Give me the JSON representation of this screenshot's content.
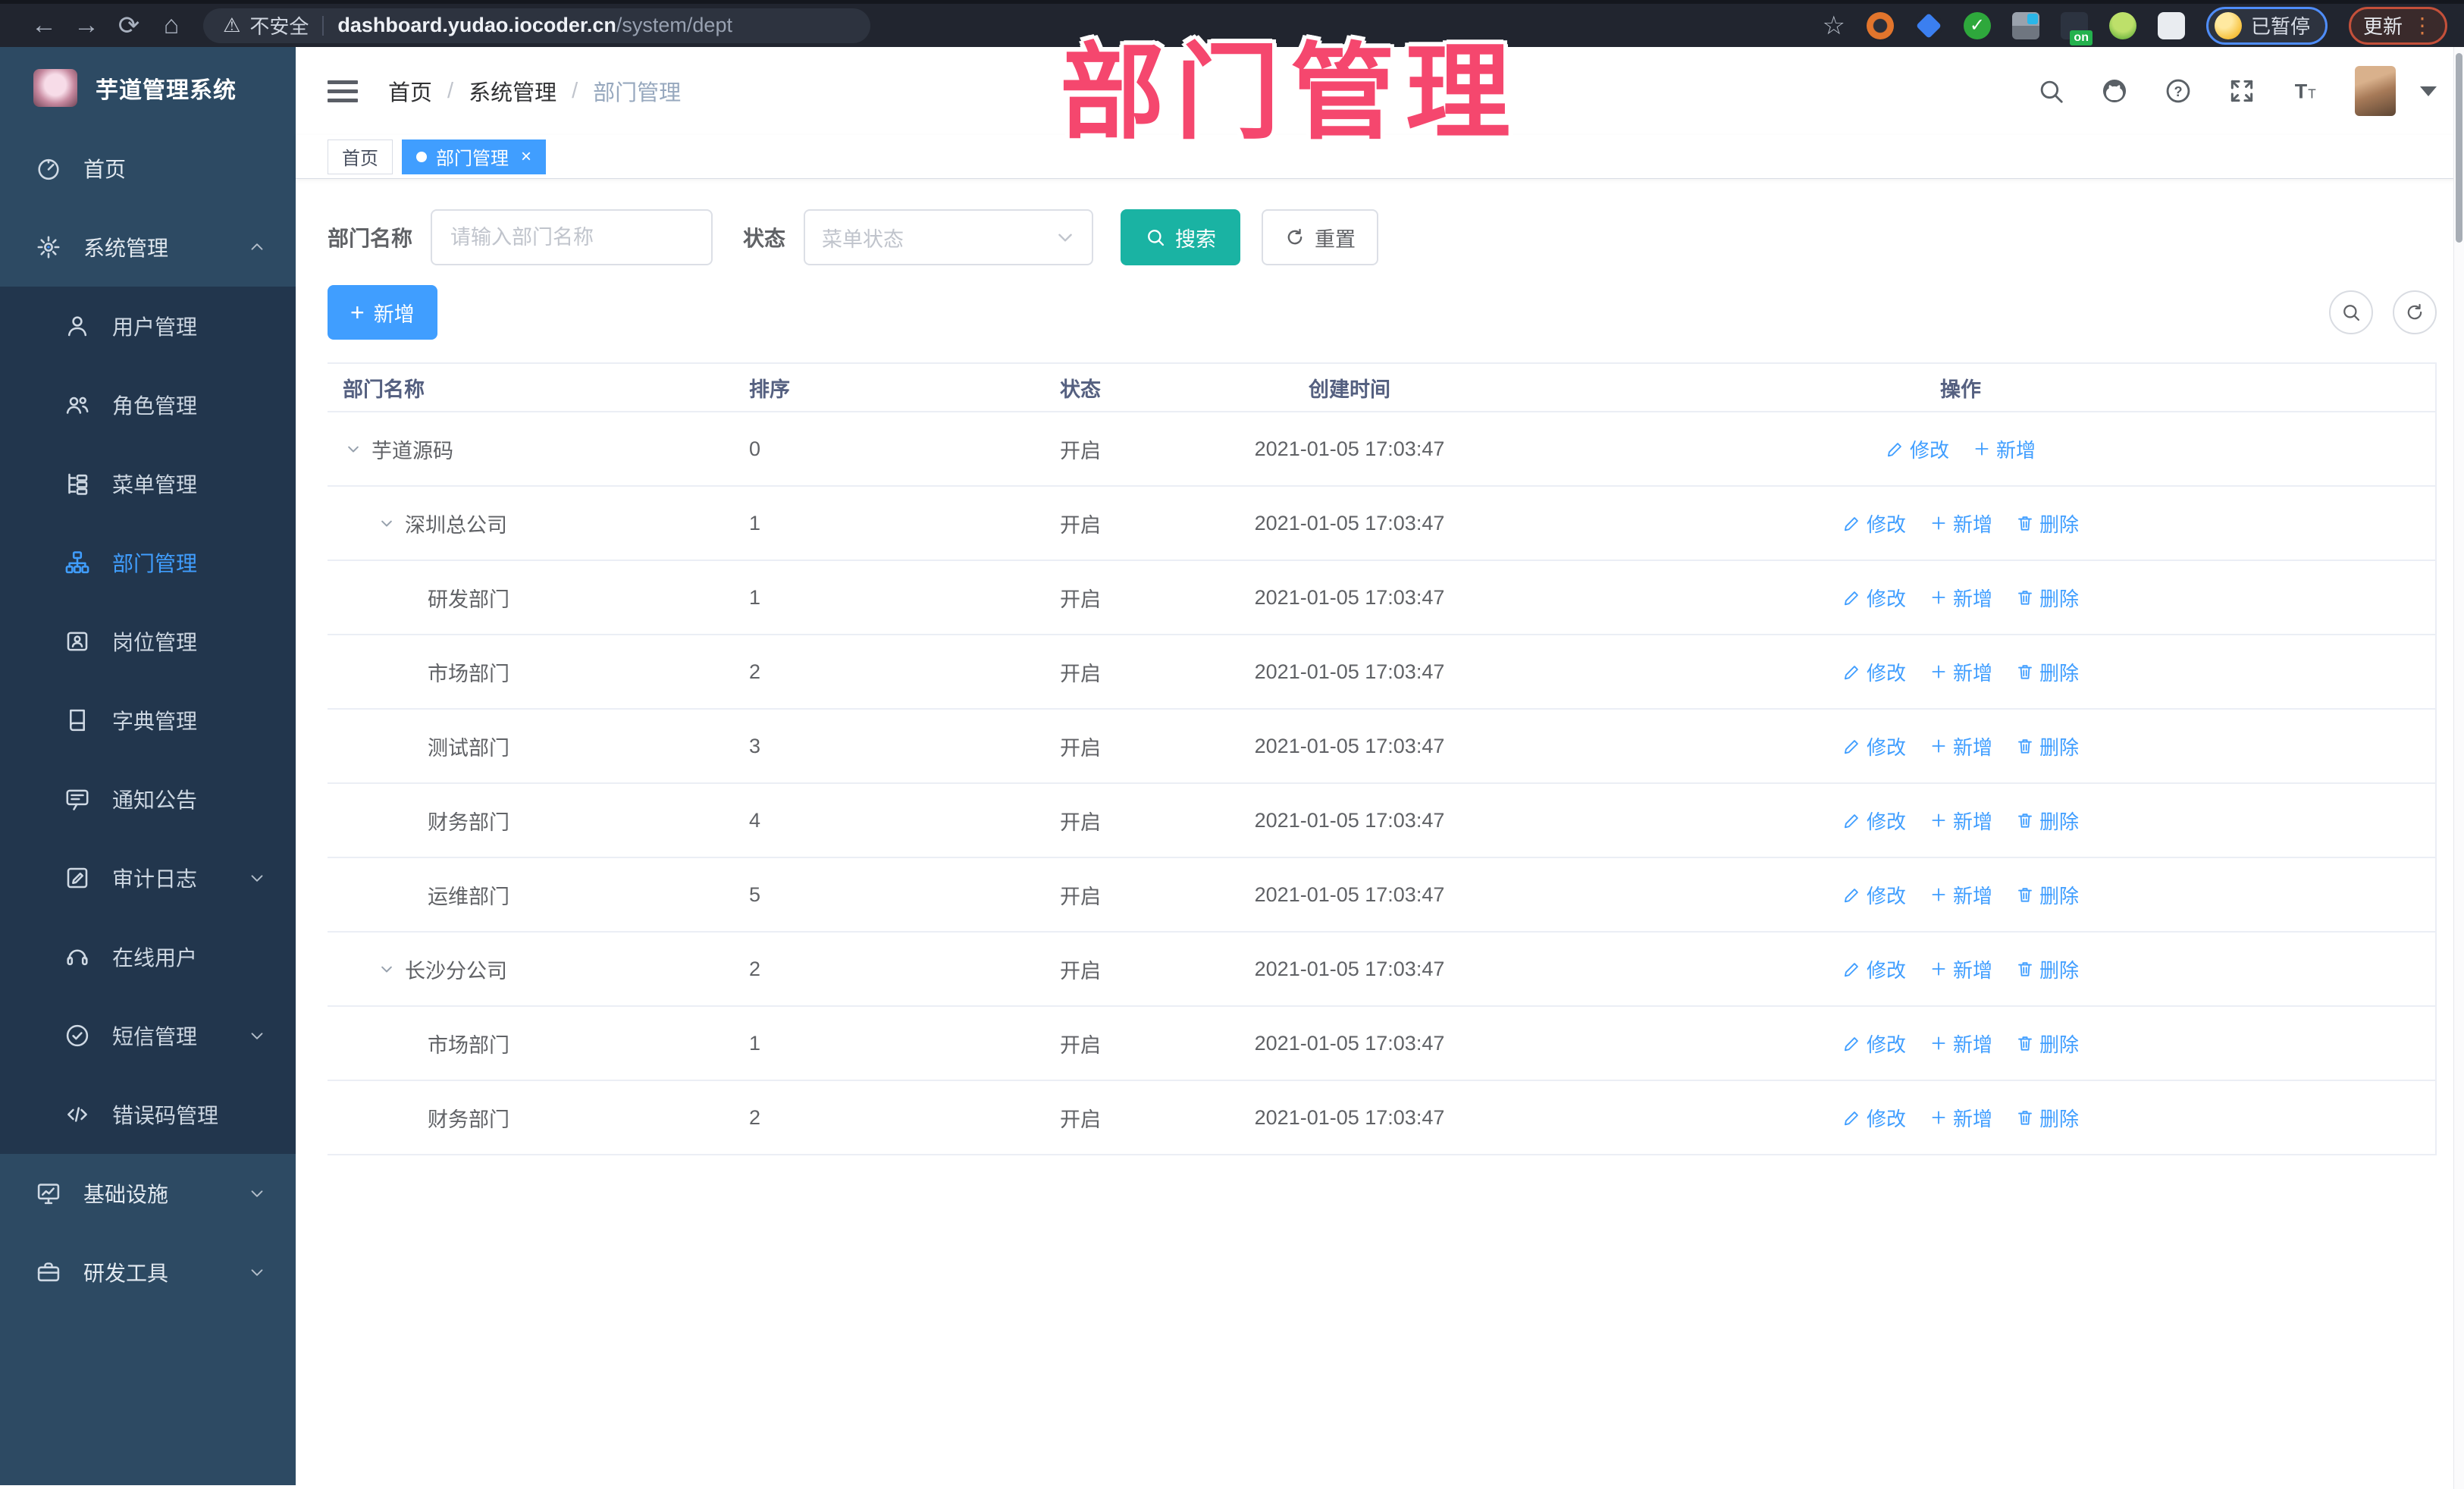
{
  "browser": {
    "security_label": "不安全",
    "url_host": "dashboard.yudao.iocoder.cn",
    "url_path": "/system/dept",
    "extension_on_badge": "on",
    "profile_status": "已暂停",
    "update_label": "更新"
  },
  "annotation": {
    "text": "部门管理",
    "color": "#f5476e"
  },
  "sidebar": {
    "title": "芋道管理系统",
    "items": [
      {
        "key": "home",
        "label": "首页",
        "icon": "dashboard-icon",
        "level": 0,
        "active": false,
        "chevron": null
      },
      {
        "key": "system",
        "label": "系统管理",
        "icon": "gear-icon",
        "level": 0,
        "active": false,
        "chevron": "up"
      },
      {
        "key": "user",
        "label": "用户管理",
        "icon": "user-icon",
        "level": 1,
        "active": false,
        "chevron": null
      },
      {
        "key": "role",
        "label": "角色管理",
        "icon": "role-icon",
        "level": 1,
        "active": false,
        "chevron": null
      },
      {
        "key": "menu",
        "label": "菜单管理",
        "icon": "menu-tree-icon",
        "level": 1,
        "active": false,
        "chevron": null
      },
      {
        "key": "dept",
        "label": "部门管理",
        "icon": "org-chart-icon",
        "level": 1,
        "active": true,
        "chevron": null
      },
      {
        "key": "post",
        "label": "岗位管理",
        "icon": "id-badge-icon",
        "level": 1,
        "active": false,
        "chevron": null
      },
      {
        "key": "dict",
        "label": "字典管理",
        "icon": "book-icon",
        "level": 1,
        "active": false,
        "chevron": null
      },
      {
        "key": "notice",
        "label": "通知公告",
        "icon": "bubble-icon",
        "level": 1,
        "active": false,
        "chevron": null
      },
      {
        "key": "audit",
        "label": "审计日志",
        "icon": "edit-log-icon",
        "level": 1,
        "active": false,
        "chevron": "down"
      },
      {
        "key": "online",
        "label": "在线用户",
        "icon": "headset-icon",
        "level": 1,
        "active": false,
        "chevron": null
      },
      {
        "key": "sms",
        "label": "短信管理",
        "icon": "check-circle-icon",
        "level": 1,
        "active": false,
        "chevron": "down"
      },
      {
        "key": "errorcode",
        "label": "错误码管理",
        "icon": "code-icon",
        "level": 1,
        "active": false,
        "chevron": null
      },
      {
        "key": "infra",
        "label": "基础设施",
        "icon": "monitor-icon",
        "level": 0,
        "active": false,
        "chevron": "down"
      },
      {
        "key": "devtools",
        "label": "研发工具",
        "icon": "briefcase-icon",
        "level": 0,
        "active": false,
        "chevron": "down"
      }
    ]
  },
  "breadcrumb": [
    "首页",
    "系统管理",
    "部门管理"
  ],
  "tags": [
    {
      "label": "首页",
      "active": false
    },
    {
      "label": "部门管理",
      "active": true
    }
  ],
  "filter": {
    "dept_label": "部门名称",
    "dept_placeholder": "请输入部门名称",
    "status_label": "状态",
    "status_placeholder": "菜单状态",
    "search_label": "搜索",
    "reset_label": "重置"
  },
  "toolbar": {
    "add_label": "新增"
  },
  "table": {
    "headers": [
      "部门名称",
      "排序",
      "状态",
      "创建时间",
      "操作"
    ],
    "action_labels": {
      "edit": "修改",
      "add": "新增",
      "del": "删除"
    },
    "rows": [
      {
        "name": "芋道源码",
        "level": 0,
        "expand": true,
        "sort": "0",
        "status": "开启",
        "created": "2021-01-05 17:03:47",
        "actions": [
          "edit",
          "add"
        ]
      },
      {
        "name": "深圳总公司",
        "level": 1,
        "expand": true,
        "sort": "1",
        "status": "开启",
        "created": "2021-01-05 17:03:47",
        "actions": [
          "edit",
          "add",
          "del"
        ]
      },
      {
        "name": "研发部门",
        "level": 2,
        "expand": false,
        "sort": "1",
        "status": "开启",
        "created": "2021-01-05 17:03:47",
        "actions": [
          "edit",
          "add",
          "del"
        ]
      },
      {
        "name": "市场部门",
        "level": 2,
        "expand": false,
        "sort": "2",
        "status": "开启",
        "created": "2021-01-05 17:03:47",
        "actions": [
          "edit",
          "add",
          "del"
        ]
      },
      {
        "name": "测试部门",
        "level": 2,
        "expand": false,
        "sort": "3",
        "status": "开启",
        "created": "2021-01-05 17:03:47",
        "actions": [
          "edit",
          "add",
          "del"
        ]
      },
      {
        "name": "财务部门",
        "level": 2,
        "expand": false,
        "sort": "4",
        "status": "开启",
        "created": "2021-01-05 17:03:47",
        "actions": [
          "edit",
          "add",
          "del"
        ]
      },
      {
        "name": "运维部门",
        "level": 2,
        "expand": false,
        "sort": "5",
        "status": "开启",
        "created": "2021-01-05 17:03:47",
        "actions": [
          "edit",
          "add",
          "del"
        ]
      },
      {
        "name": "长沙分公司",
        "level": 1,
        "expand": true,
        "sort": "2",
        "status": "开启",
        "created": "2021-01-05 17:03:47",
        "actions": [
          "edit",
          "add",
          "del"
        ]
      },
      {
        "name": "市场部门",
        "level": 2,
        "expand": false,
        "sort": "1",
        "status": "开启",
        "created": "2021-01-05 17:03:47",
        "actions": [
          "edit",
          "add",
          "del"
        ]
      },
      {
        "name": "财务部门",
        "level": 2,
        "expand": false,
        "sort": "2",
        "status": "开启",
        "created": "2021-01-05 17:03:47",
        "actions": [
          "edit",
          "add",
          "del"
        ]
      }
    ]
  },
  "colors": {
    "accent": "#409eff",
    "search_teal": "#1ab3a3",
    "sidebar_bg": "#2d4a63",
    "submenu_bg": "#22364d",
    "annotation_pink": "#f5476e"
  }
}
